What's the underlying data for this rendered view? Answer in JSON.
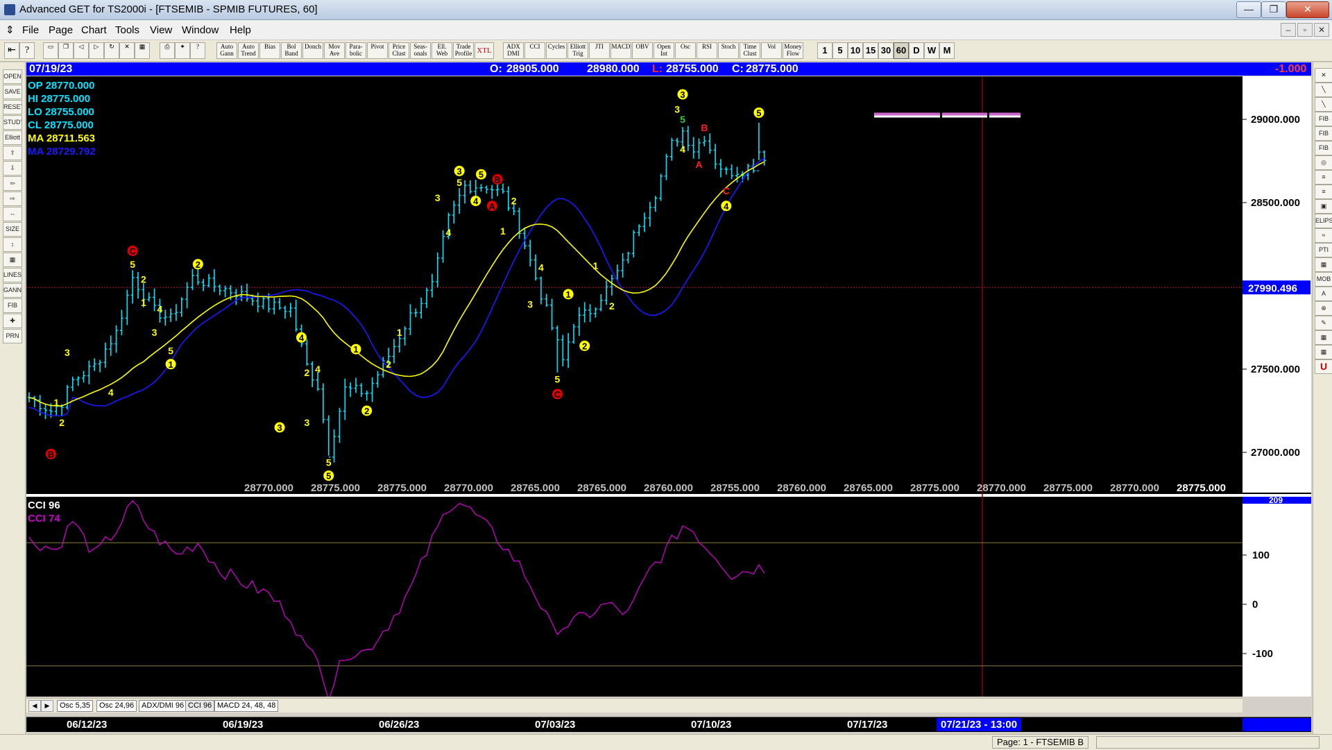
{
  "window": {
    "title": "Advanced GET for TS2000i - [FTSEMIB - SPMIB FUTURES, 60]",
    "min_glyph": "—",
    "max_glyph": "❐",
    "close_glyph": "✕"
  },
  "menu": {
    "items": [
      "File",
      "Page",
      "Chart",
      "Tools",
      "View",
      "Window",
      "Help"
    ],
    "mdi_buttons": [
      "–",
      "▫",
      "✕"
    ]
  },
  "toolbar": {
    "study_buttons": [
      "Auto Gann",
      "Auto Trend",
      "Bias",
      "Bol Band",
      "Donch",
      "Mov Ave",
      "Para-bolic",
      "Pivot",
      "Price Clust",
      "Seas-onals",
      "Ell. Web",
      "Trade Profile",
      "XTL",
      "ADX DMI",
      "CCI",
      "Cycles",
      "Elliott Trig",
      "JTI",
      "MACD",
      "OBV",
      "Open Int",
      "Osc",
      "RSI",
      "Stoch",
      "Time Clust",
      "Vol",
      "Money Flow"
    ],
    "timeframes": [
      "1",
      "5",
      "10",
      "15",
      "30",
      "60",
      "D",
      "W",
      "M"
    ],
    "active_timeframe": "60"
  },
  "left_tools": [
    "OPEN",
    "SAVE",
    "RESET",
    "STUDY",
    "Elliott",
    "⇧",
    "⇩",
    "⇦",
    "⇨",
    "⇔",
    "SIZE",
    "↕",
    "▦",
    "LINES",
    "GANN",
    "FIB",
    "✚",
    "PRN"
  ],
  "right_tools": [
    "✕",
    "╲",
    "╲",
    "FIB RET",
    "FIB EXT",
    "FIB TIME",
    "◎",
    "≡",
    "≡",
    "▣",
    "ELIPS",
    "≈",
    "PTI",
    "▦",
    "MOB",
    "A",
    "⊕",
    "✎",
    "▦",
    "▦",
    "U"
  ],
  "header": {
    "date": "07/19/23",
    "o_label": "O:",
    "o": "28905.000",
    "h": "28980.000",
    "l_label": "L:",
    "l": "28755.000",
    "c_label": "C:",
    "c": "28775.000",
    "change": "-1.000"
  },
  "stats": {
    "op": "OP  28770.000",
    "hi": "HI   28775.000",
    "lo": "LO  28755.000",
    "cl": "CL  28775.000",
    "ma1": "MA  28711.563",
    "ma2": "MA  28729.792",
    "cci1": "CCI  96",
    "cci2": "CCI  74",
    "ma1_color": "#ffff00",
    "ma2_color": "#1a1aff",
    "cci_color": "#cc00cc",
    "bar_color": "#00e5ff"
  },
  "bottom_values": [
    "28770.000",
    "28775.000",
    "28775.000",
    "28770.000",
    "28765.000",
    "28765.000",
    "28760.000",
    "28755.000",
    "28760.000",
    "28765.000",
    "28775.000",
    "28770.000",
    "28775.000",
    "28770.000",
    "28775.000"
  ],
  "price_axis": {
    "ticks": [
      29000,
      28500,
      27500,
      27000
    ],
    "tick_labels": [
      "29000.000",
      "28500.000",
      "27500.000",
      "27000.000"
    ],
    "cursor_value": 27990.496,
    "cursor_label": "27990.496",
    "range": [
      26700,
      29500
    ]
  },
  "cci_axis": {
    "ticks": [
      100,
      0,
      -100
    ],
    "tick_labels": [
      "100",
      "0",
      "-100"
    ],
    "top_label": "209",
    "range": [
      -190,
      210
    ],
    "bands": [
      125,
      -125
    ]
  },
  "tabs": [
    "Osc 5,35",
    "Osc 24,96",
    "ADX/DMI 96",
    "CCI 96",
    "MACD 24, 48, 48"
  ],
  "active_tab": "CCI 96",
  "dates": {
    "labels": [
      "06/12/23",
      "06/19/23",
      "06/26/23",
      "07/03/23",
      "07/10/23",
      "07/17/23"
    ],
    "cursor": "07/21/23 - 13:00"
  },
  "status": {
    "page": "Page: 1 - FTSEMIB B"
  },
  "waves": [
    {
      "label": "B",
      "style": "red-circle",
      "bar": 4,
      "price": 26990
    },
    {
      "label": "1",
      "style": "plain-yellow",
      "bar": 5,
      "price": 27300
    },
    {
      "label": "2",
      "style": "plain-yellow",
      "bar": 6,
      "price": 27180
    },
    {
      "label": "3",
      "style": "plain-yellow",
      "bar": 7,
      "price": 27600
    },
    {
      "label": "4",
      "style": "plain-yellow",
      "bar": 15,
      "price": 27360
    },
    {
      "label": "C",
      "style": "red-circle",
      "bar": 19,
      "price": 28210
    },
    {
      "label": "5",
      "style": "plain-yellow",
      "bar": 19,
      "price": 28130
    },
    {
      "label": "2",
      "style": "plain-yellow",
      "bar": 21,
      "price": 28040
    },
    {
      "label": "1",
      "style": "plain-yellow",
      "bar": 21,
      "price": 27900
    },
    {
      "label": "4",
      "style": "plain-yellow",
      "bar": 24,
      "price": 27860
    },
    {
      "label": "3",
      "style": "plain-yellow",
      "bar": 23,
      "price": 27720
    },
    {
      "label": "5",
      "style": "plain-yellow",
      "bar": 26,
      "price": 27610
    },
    {
      "label": "1",
      "style": "yellow-circle",
      "bar": 26,
      "price": 27530
    },
    {
      "label": "2",
      "style": "yellow-circle",
      "bar": 31,
      "price": 28130
    },
    {
      "label": "4",
      "style": "yellow-circle",
      "bar": 50,
      "price": 27690
    },
    {
      "label": "3",
      "style": "yellow-circle",
      "bar": 46,
      "price": 27150
    },
    {
      "label": "3",
      "style": "plain-yellow",
      "bar": 51,
      "price": 27180
    },
    {
      "label": "2",
      "style": "plain-yellow",
      "bar": 51,
      "price": 27480
    },
    {
      "label": "4",
      "style": "plain-yellow",
      "bar": 53,
      "price": 27500
    },
    {
      "label": "3",
      "style": "yellow-circle",
      "bar": 1000,
      "price": 0
    },
    {
      "label": "5",
      "style": "plain-yellow",
      "bar": 55,
      "price": 26940
    },
    {
      "label": "5",
      "style": "yellow-circle",
      "bar": 55,
      "price": 26860
    },
    {
      "label": "1",
      "style": "yellow-circle",
      "bar": 60,
      "price": 27620
    },
    {
      "label": "2",
      "style": "yellow-circle",
      "bar": 62,
      "price": 27250
    },
    {
      "label": "2",
      "style": "plain-yellow",
      "bar": 66,
      "price": 27530
    },
    {
      "label": "1",
      "style": "plain-yellow",
      "bar": 68,
      "price": 27720
    },
    {
      "label": "3",
      "style": "plain-yellow",
      "bar": 75,
      "price": 28530
    },
    {
      "label": "4",
      "style": "plain-yellow",
      "bar": 77,
      "price": 28320
    },
    {
      "label": "3",
      "style": "yellow-circle",
      "bar": 79,
      "price": 28690
    },
    {
      "label": "5",
      "style": "plain-yellow",
      "bar": 79,
      "price": 28620
    },
    {
      "label": "5",
      "style": "yellow-circle",
      "bar": 83,
      "price": 28670
    },
    {
      "label": "4",
      "style": "yellow-circle",
      "bar": 82,
      "price": 28510
    },
    {
      "label": "B",
      "style": "red-circle",
      "bar": 86,
      "price": 28640
    },
    {
      "label": "A",
      "style": "red-circle",
      "bar": 85,
      "price": 28480
    },
    {
      "label": "2",
      "style": "plain-yellow",
      "bar": 89,
      "price": 28510
    },
    {
      "label": "1",
      "style": "plain-yellow",
      "bar": 87,
      "price": 28330
    },
    {
      "label": "4",
      "style": "plain-yellow",
      "bar": 94,
      "price": 28110
    },
    {
      "label": "3",
      "style": "plain-yellow",
      "bar": 92,
      "price": 27890
    },
    {
      "label": "1",
      "style": "yellow-circle",
      "bar": 99,
      "price": 27950
    },
    {
      "label": "5",
      "style": "plain-yellow",
      "bar": 97,
      "price": 27440
    },
    {
      "label": "C",
      "style": "red-circle",
      "bar": 97,
      "price": 27350
    },
    {
      "label": "2",
      "style": "yellow-circle",
      "bar": 102,
      "price": 27640
    },
    {
      "label": "1",
      "style": "plain-yellow",
      "bar": 104,
      "price": 28120
    },
    {
      "label": "2",
      "style": "plain-yellow",
      "bar": 107,
      "price": 27880
    },
    {
      "label": "3",
      "style": "yellow-circle",
      "bar": 120,
      "price": 29150
    },
    {
      "label": "3",
      "style": "plain-yellow",
      "bar": 119,
      "price": 29060
    },
    {
      "label": "5",
      "style": "green",
      "bar": 120,
      "price": 29000
    },
    {
      "label": "4",
      "style": "plain-yellow",
      "bar": 120,
      "price": 28820
    },
    {
      "label": "B",
      "style": "plain-red",
      "bar": 124,
      "price": 28950
    },
    {
      "label": "A",
      "style": "plain-red",
      "bar": 123,
      "price": 28730
    },
    {
      "label": "C",
      "style": "plain-red",
      "bar": 128,
      "price": 28570
    },
    {
      "label": "4",
      "style": "yellow-circle",
      "bar": 128,
      "price": 28480
    },
    {
      "label": "5",
      "style": "yellow-circle",
      "bar": 134,
      "price": 29040
    }
  ]
}
